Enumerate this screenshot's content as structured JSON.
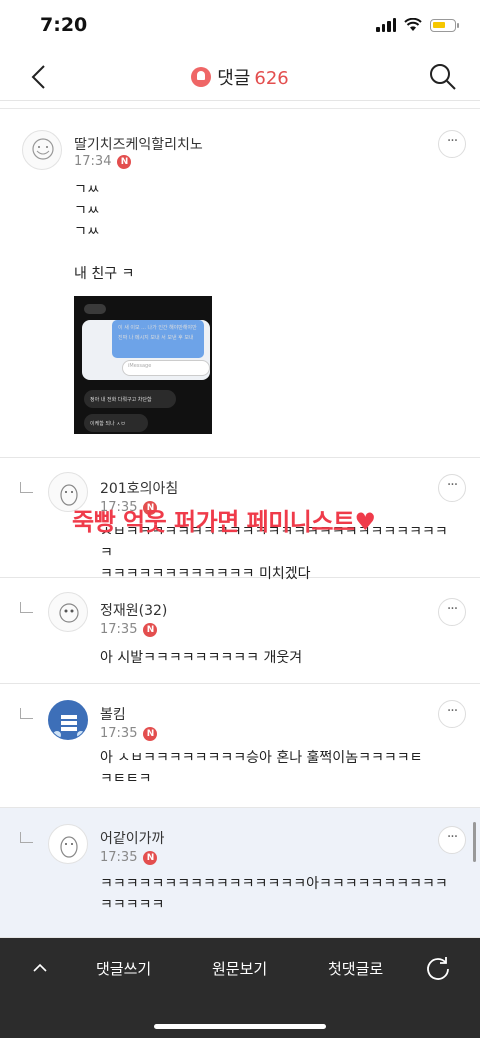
{
  "status": {
    "time": "7:20"
  },
  "header": {
    "title": "댓글",
    "count": "626"
  },
  "comments": [
    {
      "name": "딸기치즈케익할리치노",
      "time": "17:34",
      "badge": "N",
      "body": "ㄱㅆ\nㄱㅆ\nㄱㅆ\n\n내 친구 ㅋ",
      "image": {
        "lines": [
          "이 새 이모 ... 나가 인간 해야만해야만",
          "진짜 나 메시지 보내 서 보낸 후 보내",
          "iMessage",
          "정아 내 전화 다뤄구고 차단함",
          "이케함 되나 ㅅㅂ"
        ]
      }
    },
    {
      "name": "201호의아침",
      "time": "17:35",
      "badge": "N",
      "body": "ㅅㅂㅋㅋㅋㅋㅋㅋㅋㅋㅋㅋㅋㅋㅋㅋㅋㅋㅋㅋㅋㅋㅋㅋㅋㅋㅋㅋ\nㅋㅋㅋㅋㅋㅋㅋㅋㅋㅋㅋㅋ 미치겠다"
    },
    {
      "name": "정재원(32)",
      "time": "17:35",
      "badge": "N",
      "body": "아 시발ㅋㅋㅋㅋㅋㅋㅋㅋㅋ 개웃겨"
    },
    {
      "name": "볼킴",
      "time": "17:35",
      "badge": "N",
      "body": "아 ㅅㅂㅋㅋㅋㅋㅋㅋㅋㅋ승아 혼나 훌쩍이놈ㅋㅋㅋㅋㅌ\nㅋㅌㅌㅋ"
    },
    {
      "name": "어같이가까",
      "time": "17:35",
      "badge": "N",
      "body": "ㅋㅋㅋㅋㅋㅋㅋㅋㅋㅋㅋㅋㅋㅋㅋㅋ아ㅋㅋㅋㅋㅋㅋㅋㅋㅋㅋ\nㅋㅋㅋㅋㅋ"
    }
  ],
  "overlay_text": "죽빵 억웃 퍼가면 페미니스트♥",
  "more_label": "···",
  "bottom": {
    "write": "댓글쓰기",
    "original": "원문보기",
    "first": "첫댓글로"
  },
  "colors": {
    "accent": "#e34e4e",
    "overlay": "#ef3b4a",
    "bottombar": "#2c2c2c"
  }
}
